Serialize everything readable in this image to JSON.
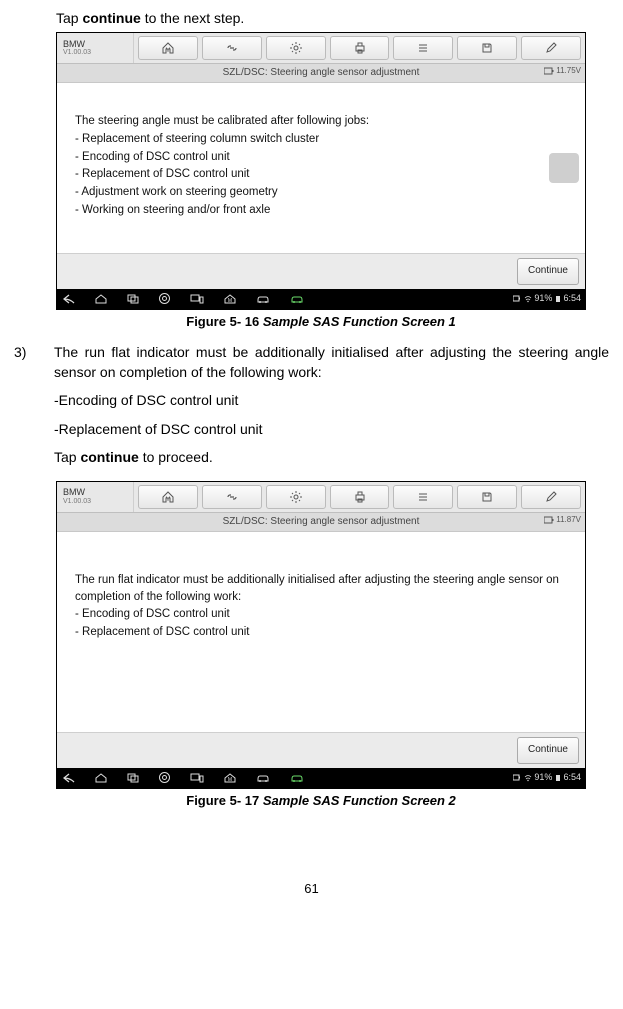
{
  "page_number": "61",
  "intro_line_prefix": "Tap ",
  "intro_line_bold": "continue",
  "intro_line_suffix": " to the next step.",
  "fig1": {
    "brand": "BMW",
    "version": "V1.00.03",
    "greybar_title": "SZL/DSC: Steering angle sensor adjustment",
    "voltage": "11.75V",
    "content_header": "The steering angle must be calibrated after following jobs:",
    "content_lines": [
      "- Replacement of steering column switch cluster",
      "- Encoding of DSC control unit",
      "- Replacement of DSC control unit",
      "- Adjustment work on steering geometry",
      "- Working on steering and/or front axle"
    ],
    "continue_label": "Continue",
    "status_signal": "91%",
    "status_time": "6:54",
    "caption_fig": "Figure 5- 16",
    "caption_title": "Sample SAS Function Screen 1"
  },
  "step3": {
    "number": "3)",
    "para1": "The run flat indicator must be additionally initialised after adjusting the steering angle sensor on completion of the following work:",
    "bullet1": "-Encoding of DSC control unit",
    "bullet2": "-Replacement of DSC control unit",
    "para2_prefix": "Tap ",
    "para2_bold": "continue",
    "para2_suffix": " to proceed."
  },
  "fig2": {
    "brand": "BMW",
    "version": "V1.00.03",
    "greybar_title": "SZL/DSC: Steering angle sensor adjustment",
    "voltage": "11.87V",
    "content_header": "The run flat indicator must be additionally initialised after adjusting the steering angle sensor on completion of the following work:",
    "content_lines": [
      "- Encoding of DSC control unit",
      "- Replacement of DSC control unit"
    ],
    "continue_label": "Continue",
    "status_signal": "91%",
    "status_time": "6:54",
    "caption_fig": "Figure 5- 17",
    "caption_title": "Sample SAS Function Screen 2"
  }
}
